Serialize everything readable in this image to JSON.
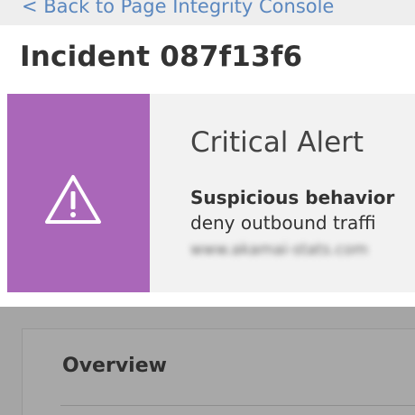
{
  "nav": {
    "back_label": "< Back to Page Integrity Console"
  },
  "header": {
    "title": "Incident 087f13f6"
  },
  "alert": {
    "heading": "Critical Alert",
    "description": "Suspicious behavior",
    "action": "deny outbound traffi",
    "domain": "www.akamai-stats.com",
    "icon": "warning-triangle-icon",
    "accent_color": "#aa67b9"
  },
  "overview": {
    "title": "Overview"
  }
}
